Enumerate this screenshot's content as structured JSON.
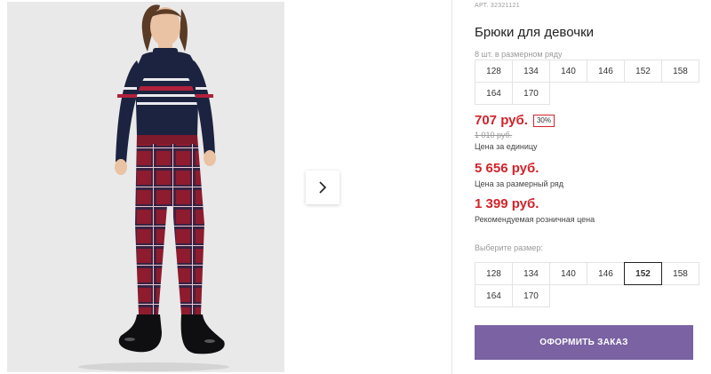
{
  "product": {
    "article": "АРТ. 32321121",
    "title": "Брюки для девочки",
    "pack_label": "8 шт. в размерном ряду",
    "pack_sizes": [
      "128",
      "134",
      "140",
      "146",
      "152",
      "158",
      "164",
      "170"
    ],
    "price": "707 руб.",
    "discount_badge": "30%",
    "old_price": "1 010 руб.",
    "unit_price_caption": "Цена за единицу",
    "pack_price": "5 656 руб.",
    "pack_price_caption": "Цена за размерный ряд",
    "retail_price": "1 399 руб.",
    "retail_price_caption": "Рекомендуемая розничная цена",
    "choose_size_label": "Выберите размер:",
    "sizes": [
      "128",
      "134",
      "140",
      "146",
      "152",
      "158",
      "164",
      "170"
    ],
    "selected_size": "152",
    "order_button": "ОФОРМИТЬ ЗАКАЗ"
  },
  "colors": {
    "price_red": "#d2232a",
    "order_button_bg": "#7a62a3",
    "photo_bg": "#e9e9e9"
  },
  "icons": {
    "next_arrow": "chevron-right-icon"
  }
}
